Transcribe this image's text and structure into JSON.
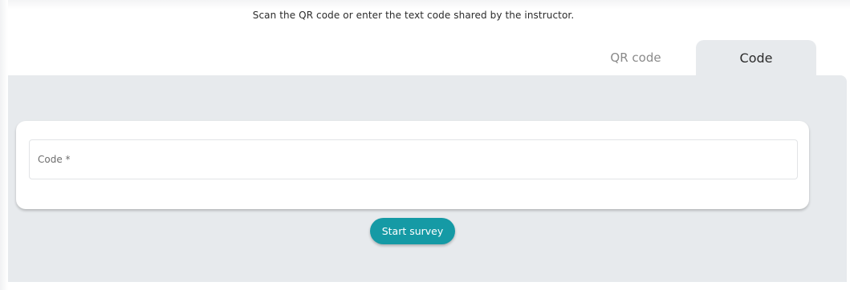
{
  "instruction": "Scan the QR code or enter the text code shared by the instructor.",
  "tabs": [
    {
      "label": "QR code",
      "active": false
    },
    {
      "label": "Code",
      "active": true
    }
  ],
  "form": {
    "code_placeholder": "Code *",
    "code_value": ""
  },
  "actions": {
    "start_label": "Start survey"
  },
  "colors": {
    "accent": "#159aa5",
    "panel_bg": "#e7eaed",
    "card_bg": "#ffffff"
  }
}
